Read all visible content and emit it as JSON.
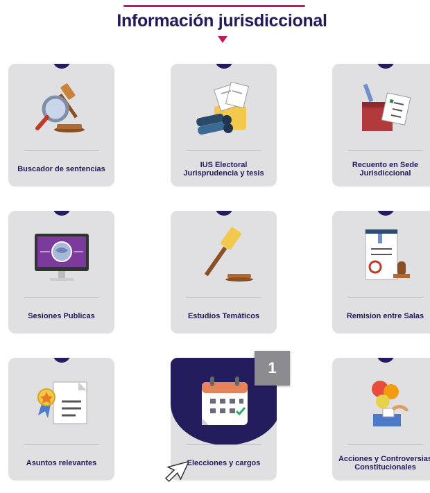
{
  "header": {
    "title": "Información jurisdiccional"
  },
  "cards": [
    {
      "label": "Buscador de sentencias",
      "icon": "gavel-magnifier-icon"
    },
    {
      "label": "IUS Electoral Jurisprudencia y tesis",
      "icon": "binoculars-documents-icon"
    },
    {
      "label": "Recuento en Sede Jurisdiccional",
      "icon": "ballot-box-checklist-icon"
    },
    {
      "label": "Sesiones Publicas",
      "icon": "monitor-globe-icon"
    },
    {
      "label": "Estudios Temáticos",
      "icon": "gavel-icon"
    },
    {
      "label": "Remision entre Salas",
      "icon": "document-stamp-icon"
    },
    {
      "label": "Asuntos relevantes",
      "icon": "certificate-ribbon-icon"
    },
    {
      "label": "Elecciones y cargos",
      "icon": "calendar-icon"
    },
    {
      "label": "Acciones y Controversias Constitucionales",
      "icon": "vote-speech-bubbles-icon"
    }
  ],
  "badge": {
    "value": "1"
  },
  "colors": {
    "brand": "#221a5a",
    "accent": "#c2185b",
    "card": "#e0e0e3"
  }
}
